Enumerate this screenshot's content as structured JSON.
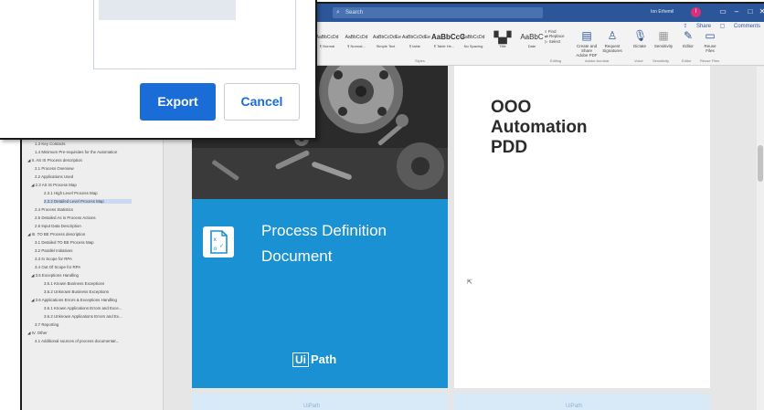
{
  "dialog": {
    "export_label": "Export",
    "cancel_label": "Cancel"
  },
  "word": {
    "search_placeholder": "Search",
    "user_name": "Ion Erhemil",
    "user_initial": "I",
    "share_label": "Share",
    "comments_label": "Comments",
    "styles": [
      "AaBbCcDd",
      "AaBbCcDd",
      "AaBbCcDdEe",
      "AaBbCcDdEe",
      "AaBbCcC",
      "AaBbCcDd",
      "AaBbC",
      "AaBbC"
    ],
    "style_names": [
      "¶ Normal",
      "¶ Normal...",
      "Simple Text",
      "¶ table",
      "¶ Table He...",
      "No Spacing",
      "Title",
      "Date"
    ],
    "groups": {
      "styles": "Styles",
      "editing": "Editing",
      "adobe": "Adobe Acrobat",
      "voice": "Voice",
      "sensitivity": "Sensitivity",
      "editor": "Editor",
      "reuse": "Reuse Files"
    },
    "editing": [
      "Find",
      "Replace",
      "Select"
    ],
    "ribbon_buttons": [
      "Create and Share Adobe PDF",
      "Request Signatures",
      "Dictate",
      "Sensitivity",
      "Editor",
      "Reuse Files"
    ]
  },
  "nav": {
    "items": [
      "1.3 Key Contacts",
      "1.4 Minimum Pre-requisites for the Automation",
      "II. AS IS Process description",
      "2.1 Process Overview",
      "2.2 Applications Used",
      "2.3 AS IS Process Map",
      "2.3.1 High Level Process Map",
      "2.3.2 Detailed Level Process Map",
      "2.4 Process Statistics",
      "2.5 Detailed As Is Process Actions",
      "2.6 Input Data Description",
      "III. TO BE Process description",
      "3.1 Detailed TO BE Process Map",
      "3.2 Parallel Initiatives",
      "3.3 In Scope for RPA",
      "3.4 Out Of Scope for RPA",
      "3.5 Exceptions Handling",
      "3.5.1 Known Business Exceptions",
      "3.5.2 Unknown Business Exceptions",
      "3.6 Applications Errors & Exceptions Handling",
      "3.6.1 Known Applications Errors and Exce...",
      "3.6.2 Unknown Applications Errors and Ex...",
      "3.7 Reporting",
      "IV. Other",
      "4.1 Additional sources of process documentat..."
    ]
  },
  "document": {
    "cover_title_line1": "Process Definition",
    "cover_title_line2": "Document",
    "logo_ui": "Ui",
    "logo_path": "Path",
    "page2_title": [
      "OOO",
      "Automation",
      "PDD"
    ],
    "mini_logo": "UiPath"
  },
  "colors": {
    "word_blue": "#2b579a",
    "cover_blue": "#1991d3",
    "export_blue": "#1a6dd6"
  }
}
